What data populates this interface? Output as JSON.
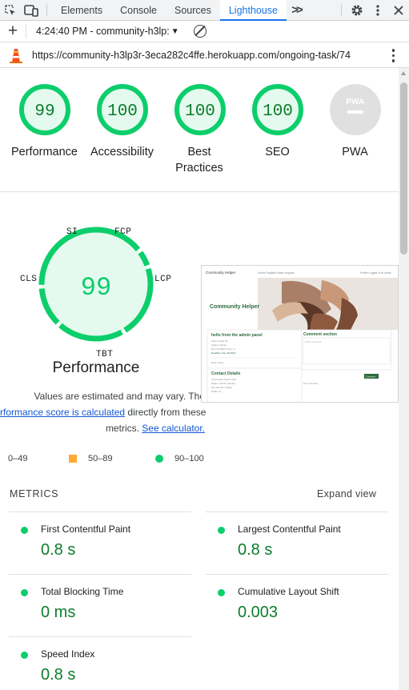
{
  "devtools": {
    "tabs": [
      "Elements",
      "Console",
      "Sources",
      "Lighthouse"
    ],
    "active_tab": "Lighthouse"
  },
  "report_bar": {
    "selected_report": "4:24:40 PM - community-h3lp:"
  },
  "url_bar": {
    "url": "https://community-h3lp3r-3eca282c4ffe.herokuapp.com/ongoing-task/74"
  },
  "categories": [
    {
      "label": "Performance",
      "score": "99"
    },
    {
      "label": "Accessibility",
      "score": "100"
    },
    {
      "label": "Best Practices",
      "score": "100"
    },
    {
      "label": "SEO",
      "score": "100"
    },
    {
      "label": "PWA",
      "score": ""
    }
  ],
  "pwa_badge": "PWA",
  "performance": {
    "score": "99",
    "title": "Performance",
    "metric_labels": {
      "si": "SI",
      "fcp": "FCP",
      "lcp": "LCP",
      "tbt": "TBT",
      "cls": "CLS"
    },
    "estimate_text_1": "Values are estimated and may vary. The",
    "estimate_link_1": "rformance score is calculated",
    "estimate_text_2": " directly from these",
    "estimate_text_3": "metrics. ",
    "estimate_link_2": "See calculator."
  },
  "legend": {
    "fail": "0–49",
    "average": "50–89",
    "pass": "90–100"
  },
  "metrics": {
    "heading": "METRICS",
    "expand_label": "Expand view",
    "items": [
      {
        "name": "First Contentful Paint",
        "value": "0.8 s"
      },
      {
        "name": "Largest Contentful Paint",
        "value": "0.8 s"
      },
      {
        "name": "Total Blocking Time",
        "value": "0 ms"
      },
      {
        "name": "Cumulative Layout Shift",
        "value": "0.003"
      },
      {
        "name": "Speed Index",
        "value": "0.8 s"
      }
    ]
  },
  "screenshot": {
    "site_name": "Community Helper",
    "nav_brand": "Community Helper",
    "nav_links": "Home  Register  Make request",
    "nav_right": "Profile  Logged in as admin",
    "card_title": "hello from the admin panel",
    "card_lines": [
      "Paul is Held On",
      "Helper: Admin",
      "Dec 12 2023 3:13 p.m.",
      "Deadline: Dec 28 2023",
      "Enter name"
    ],
    "comment_title": "Comment section",
    "comment_placeholder": "Enter comment",
    "comment_button": "Comment",
    "no_comments": "No comments",
    "contact_title": "Contact Details",
    "contact_lines": [
      "community helper team",
      "Helper: Admin (admin)",
      "Psy Service Village",
      "Dublin 17"
    ]
  },
  "colors": {
    "pass_green": "#0cce6b",
    "pass_text": "#0c7d2d",
    "pass_fill": "#e5faef",
    "average_orange": "#ffaa33",
    "fail_red": "#ff3333",
    "pwa_gray": "#e0e0e0",
    "link_blue": "#1558d6",
    "tab_active_blue": "#1a73e8"
  },
  "icons": [
    "inspect-element-icon",
    "device-toolbar-icon",
    "more-tabs-icon",
    "settings-gear-icon",
    "kebab-menu-icon",
    "close-icon",
    "add-report-icon",
    "clear-icon",
    "lighthouse-logo-icon"
  ]
}
